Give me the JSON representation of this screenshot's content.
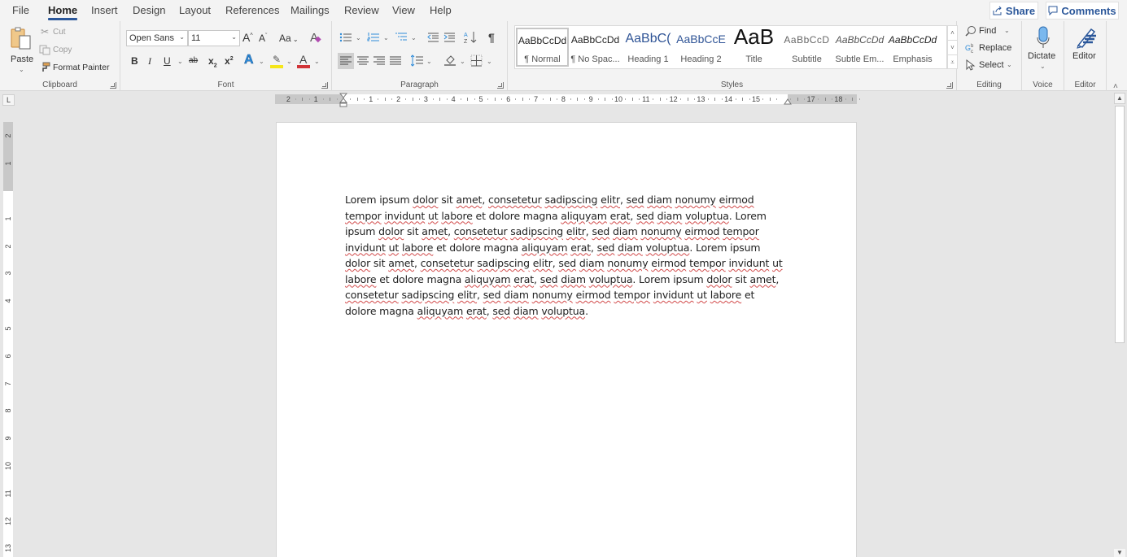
{
  "tabs": [
    {
      "label": "File"
    },
    {
      "label": "Home",
      "active": true
    },
    {
      "label": "Insert"
    },
    {
      "label": "Design"
    },
    {
      "label": "Layout"
    },
    {
      "label": "References"
    },
    {
      "label": "Mailings"
    },
    {
      "label": "Review"
    },
    {
      "label": "View"
    },
    {
      "label": "Help"
    }
  ],
  "header": {
    "share_label": "Share",
    "comments_label": "Comments"
  },
  "clipboard": {
    "group_label": "Clipboard",
    "paste_label": "Paste",
    "cut_label": "Cut",
    "copy_label": "Copy",
    "format_painter_label": "Format Painter"
  },
  "font": {
    "group_label": "Font",
    "font_name": "Open Sans",
    "font_size": "11",
    "grow_label": "A",
    "shrink_label": "A",
    "change_case_label": "Aa",
    "bold": "B",
    "italic": "I",
    "underline": "U",
    "strikethrough": "ab",
    "subscript": "x",
    "superscript": "x",
    "text_effects": "A",
    "font_color": "A",
    "highlight_color": "#f5e61a",
    "font_color_hex": "#d13438"
  },
  "paragraph": {
    "group_label": "Paragraph",
    "pilcrow": "¶"
  },
  "styles": {
    "group_label": "Styles",
    "items": [
      {
        "sample": "AaBbCcDd",
        "name": "¶ Normal",
        "selected": true
      },
      {
        "sample": "AaBbCcDd",
        "name": "¶ No Spac..."
      },
      {
        "sample": "AaBbC(",
        "name": "Heading 1"
      },
      {
        "sample": "AaBbCcE",
        "name": "Heading 2"
      },
      {
        "sample": "AaB",
        "name": "Title"
      },
      {
        "sample": "AaBbCcD",
        "name": "Subtitle"
      },
      {
        "sample": "AaBbCcDd",
        "name": "Subtle Em..."
      },
      {
        "sample": "AaBbCcDd",
        "name": "Emphasis"
      }
    ]
  },
  "editing": {
    "group_label": "Editing",
    "find_label": "Find",
    "replace_label": "Replace",
    "select_label": "Select"
  },
  "voice": {
    "group_label": "Voice",
    "dictate_label": "Dictate"
  },
  "editor": {
    "group_label": "Editor",
    "editor_label": "Editor"
  },
  "ruler": {
    "corner": "L",
    "h_numbers": [
      "2",
      "1",
      "",
      "1",
      "2",
      "3",
      "4",
      "5",
      "6",
      "7",
      "8",
      "9",
      "10",
      "11",
      "12",
      "13",
      "14",
      "15",
      "",
      "17",
      "18"
    ],
    "v_numbers": [
      "2",
      "1",
      "",
      "1",
      "2",
      "3",
      "4",
      "5",
      "6",
      "7",
      "8",
      "9",
      "10",
      "11",
      "12",
      "13"
    ]
  },
  "document": {
    "lines": [
      [
        [
          "Lorem ipsum ",
          0
        ],
        [
          "dolor",
          1
        ],
        [
          " sit ",
          0
        ],
        [
          "amet",
          1
        ],
        [
          ", ",
          0
        ],
        [
          "consetetur",
          1
        ],
        [
          " ",
          0
        ],
        [
          "sadipscing",
          1
        ],
        [
          " ",
          0
        ],
        [
          "elitr",
          1
        ],
        [
          ", ",
          0
        ],
        [
          "sed",
          1
        ],
        [
          " ",
          0
        ],
        [
          "diam",
          1
        ],
        [
          " ",
          0
        ],
        [
          "nonumy",
          1
        ],
        [
          " ",
          0
        ],
        [
          "eirmod",
          1
        ]
      ],
      [
        [
          "tempor",
          1
        ],
        [
          " ",
          0
        ],
        [
          "invidunt",
          1
        ],
        [
          " ",
          0
        ],
        [
          "ut",
          1
        ],
        [
          " ",
          0
        ],
        [
          "labore",
          1
        ],
        [
          " et dolore magna ",
          0
        ],
        [
          "aliquyam",
          1
        ],
        [
          " ",
          0
        ],
        [
          "erat",
          1
        ],
        [
          ", ",
          0
        ],
        [
          "sed",
          1
        ],
        [
          " ",
          0
        ],
        [
          "diam",
          1
        ],
        [
          " ",
          0
        ],
        [
          "voluptua",
          1
        ],
        [
          ". Lorem",
          0
        ]
      ],
      [
        [
          "ipsum ",
          0
        ],
        [
          "dolor",
          1
        ],
        [
          " sit ",
          0
        ],
        [
          "amet",
          1
        ],
        [
          ", ",
          0
        ],
        [
          "consetetur",
          1
        ],
        [
          " ",
          0
        ],
        [
          "sadipscing",
          1
        ],
        [
          " ",
          0
        ],
        [
          "elitr",
          1
        ],
        [
          ", ",
          0
        ],
        [
          "sed",
          1
        ],
        [
          " ",
          0
        ],
        [
          "diam",
          1
        ],
        [
          " ",
          0
        ],
        [
          "nonumy",
          1
        ],
        [
          " ",
          0
        ],
        [
          "eirmod",
          1
        ],
        [
          " ",
          0
        ],
        [
          "tempor",
          1
        ]
      ],
      [
        [
          "invidunt",
          1
        ],
        [
          " ",
          0
        ],
        [
          "ut",
          1
        ],
        [
          " ",
          0
        ],
        [
          "labore",
          1
        ],
        [
          " et dolore magna ",
          0
        ],
        [
          "aliquyam",
          1
        ],
        [
          " ",
          0
        ],
        [
          "erat",
          1
        ],
        [
          ", ",
          0
        ],
        [
          "sed",
          1
        ],
        [
          " ",
          0
        ],
        [
          "diam",
          1
        ],
        [
          " ",
          0
        ],
        [
          "voluptua",
          1
        ],
        [
          ". Lorem ipsum",
          0
        ]
      ],
      [
        [
          "dolor",
          1
        ],
        [
          " sit ",
          0
        ],
        [
          "amet",
          1
        ],
        [
          ", ",
          0
        ],
        [
          "consetetur",
          1
        ],
        [
          " ",
          0
        ],
        [
          "sadipscing",
          1
        ],
        [
          " ",
          0
        ],
        [
          "elitr",
          1
        ],
        [
          ", ",
          0
        ],
        [
          "sed",
          1
        ],
        [
          " ",
          0
        ],
        [
          "diam",
          1
        ],
        [
          " ",
          0
        ],
        [
          "nonumy",
          1
        ],
        [
          " ",
          0
        ],
        [
          "eirmod",
          1
        ],
        [
          " ",
          0
        ],
        [
          "tempor",
          1
        ],
        [
          " ",
          0
        ],
        [
          "invidunt",
          1
        ],
        [
          " ",
          0
        ],
        [
          "ut",
          1
        ]
      ],
      [
        [
          "labore",
          1
        ],
        [
          " et dolore magna ",
          0
        ],
        [
          "aliquyam",
          1
        ],
        [
          " ",
          0
        ],
        [
          "erat",
          1
        ],
        [
          ", ",
          0
        ],
        [
          "sed",
          1
        ],
        [
          " ",
          0
        ],
        [
          "diam",
          1
        ],
        [
          " ",
          0
        ],
        [
          "voluptua",
          1
        ],
        [
          ". Lorem ipsum ",
          0
        ],
        [
          "dolor",
          1
        ],
        [
          " sit ",
          0
        ],
        [
          "amet",
          1
        ],
        [
          ",",
          0
        ]
      ],
      [
        [
          "consetetur",
          1
        ],
        [
          " ",
          0
        ],
        [
          "sadipscing",
          1
        ],
        [
          " ",
          0
        ],
        [
          "elitr",
          1
        ],
        [
          ", ",
          0
        ],
        [
          "sed",
          1
        ],
        [
          " ",
          0
        ],
        [
          "diam",
          1
        ],
        [
          " ",
          0
        ],
        [
          "nonumy",
          1
        ],
        [
          " ",
          0
        ],
        [
          "eirmod",
          1
        ],
        [
          " ",
          0
        ],
        [
          "tempor",
          1
        ],
        [
          " ",
          0
        ],
        [
          "invidunt",
          1
        ],
        [
          " ",
          0
        ],
        [
          "ut",
          1
        ],
        [
          " ",
          0
        ],
        [
          "labore",
          1
        ],
        [
          " et",
          0
        ]
      ],
      [
        [
          "dolore magna ",
          0
        ],
        [
          "aliquyam",
          1
        ],
        [
          " ",
          0
        ],
        [
          "erat",
          1
        ],
        [
          ", ",
          0
        ],
        [
          "sed",
          1
        ],
        [
          " ",
          0
        ],
        [
          "diam",
          1
        ],
        [
          " ",
          0
        ],
        [
          "voluptua",
          1
        ],
        [
          ".",
          0
        ]
      ]
    ]
  }
}
